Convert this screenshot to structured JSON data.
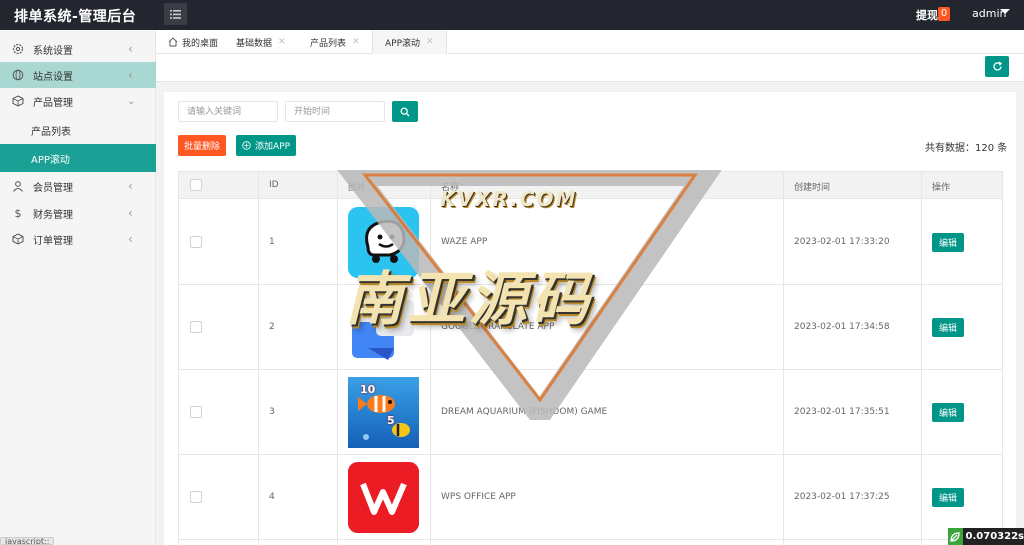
{
  "header": {
    "brand": "排单系统-管理后台",
    "withdraw_label": "提现",
    "withdraw_count": "0",
    "user": "admin"
  },
  "sidebar": {
    "items": [
      {
        "label": "系统设置",
        "icon": "gear-icon"
      },
      {
        "label": "站点设置",
        "icon": "globe-icon"
      },
      {
        "label": "产品管理",
        "icon": "box-icon"
      },
      {
        "label": "产品列表"
      },
      {
        "label": "APP滚动"
      },
      {
        "label": "会员管理",
        "icon": "user-icon"
      },
      {
        "label": "财务管理",
        "icon": "dollar-icon"
      },
      {
        "label": "订单管理",
        "icon": "box-icon"
      }
    ]
  },
  "tabs": [
    {
      "label": "我的桌面"
    },
    {
      "label": "基础数据"
    },
    {
      "label": "产品列表"
    },
    {
      "label": "APP滚动"
    }
  ],
  "filters": {
    "keyword_placeholder": "请输入关键词",
    "date_placeholder": "开始时间"
  },
  "actions": {
    "batch_delete": "批量删除",
    "add_app": "添加APP",
    "total": "共有数据：120 条"
  },
  "table": {
    "headers": [
      "ID",
      "图片",
      "名称",
      "创建时间",
      "操作"
    ],
    "rows": [
      {
        "id": "1",
        "name": "WAZE APP",
        "created": "2023-02-01 17:33:20",
        "action": "编辑"
      },
      {
        "id": "2",
        "name": "GOOGLE TRANSLATE APP",
        "created": "2023-02-01 17:34:58",
        "action": "编辑"
      },
      {
        "id": "3",
        "name": "DREAM AQUARIUM (FISHDOM) GAME",
        "created": "2023-02-01 17:35:51",
        "action": "编辑"
      },
      {
        "id": "4",
        "name": "WPS OFFICE APP",
        "created": "2023-02-01 17:37:25",
        "action": "编辑"
      }
    ]
  },
  "status": {
    "js": "javascript:;",
    "timer": "0.070322s"
  },
  "watermark": {
    "url": "KVXR.COM",
    "text": "南亚源码"
  },
  "colors": {
    "primary": "#009688",
    "danger": "#ff5722",
    "header": "#23262e"
  }
}
